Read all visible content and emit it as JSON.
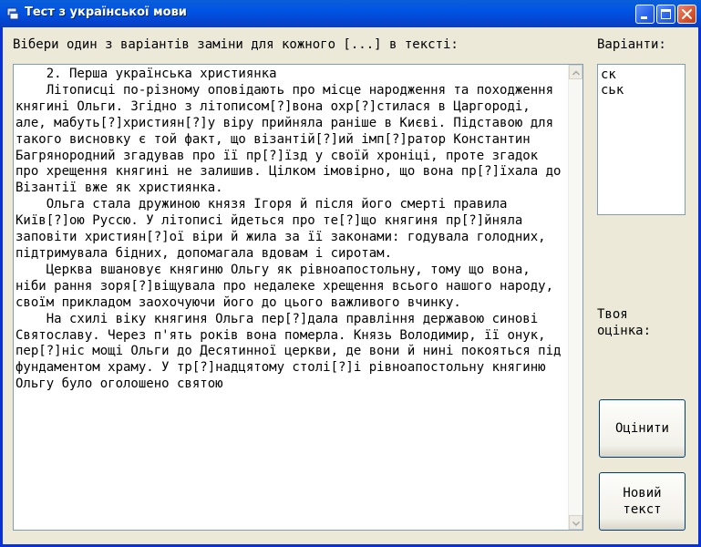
{
  "window": {
    "title": "Тест з української мови",
    "icon": "app-icon",
    "controls": [
      "minimize-icon",
      "maximize-icon",
      "close-icon"
    ]
  },
  "instruction": "Вібери один з варіантів заміни для кожного [...] в тексті:",
  "variants_label": "Варіанти:",
  "variants": [
    "ск",
    "ськ"
  ],
  "grade_label": "Твоя оцінка:",
  "text": "    2. Перша українська християнка\n    Літописці по-різному оповідають про місце народження та походження княгині Ольги. Згідно з літописом[?]вона охр[?]стилася в Царгороді, але, мабуть[?]християн[?]у віру прийняла раніше в Києві. Підставою для такого висновку є той факт, що візантій[?]ий імп[?]ратор Константин Багрянородний згадував про її пр[?]їзд у своїй хроніці, проте згадок про хрещення княгині не залишив. Цілком імовірно, що вона пр[?]їхала до Візантії вже як християнка.\n    Ольга стала дружиною князя Ігоря й після його смерті правила Київ[?]ою Руссю. У літописі йдеться про те[?]що княгиня пр[?]йняла заповіти християн[?]ої віри й жила за її законами: годувала голодних, підтримувала бідних, допомагала вдовам і сиротам.\n    Церква вшановує княгиню Ольгу як рівноапостольну, тому що вона, ніби рання зоря[?]віщувала про недалеке хрещення всього нашого народу, своїм прикладом заохочуючи його до цього важливого вчинку.\n    На схилі віку княгиня Ольга пер[?]дала правління державою синові Святославу. Через п'ять років вона померла. Князь Володимир, її онук, пер[?]ніс мощі Ольги до Десятинної церкви, де вони й нині покояться під фундаментом храму. У тр[?]надцятому столі[?]і рівноапостольну княгиню Ольгу було оголошено святою",
  "buttons": {
    "evaluate": "Оцінити",
    "new_text": "Новий\nтекст"
  },
  "colors": {
    "titlebar": "#0054e3",
    "window_bg": "#ece9d8",
    "field_border": "#7f9db9",
    "close_button": "#d8542e"
  }
}
